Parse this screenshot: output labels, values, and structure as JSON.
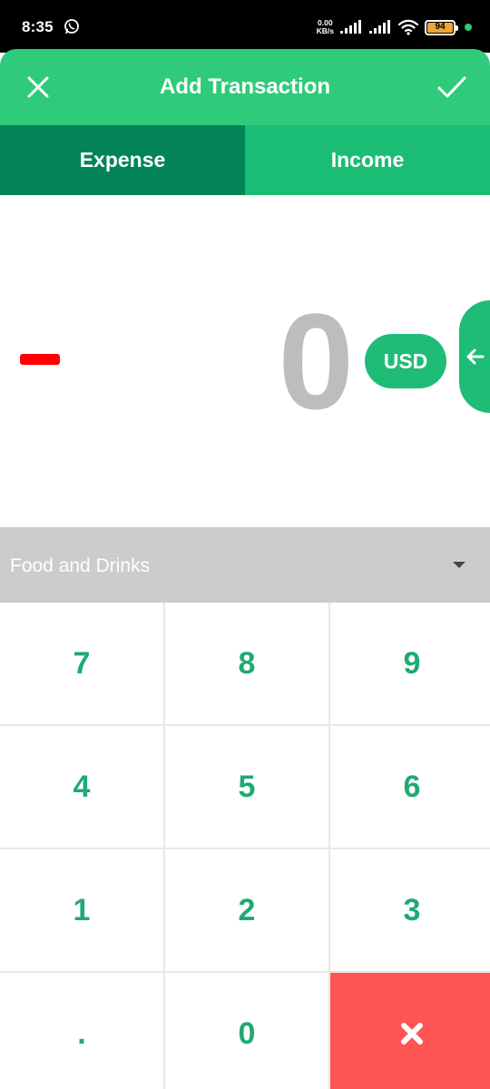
{
  "status_bar": {
    "time": "8:35",
    "net_speed_value": "0.00",
    "net_speed_unit": "KB/s",
    "battery": "94",
    "icons": [
      "whatsapp-icon",
      "signal-icon",
      "signal-icon",
      "wifi-icon",
      "battery-icon"
    ]
  },
  "app_bar": {
    "title": "Add Transaction",
    "close_icon": "close-icon",
    "confirm_icon": "check-icon"
  },
  "tabs": [
    {
      "label": "Expense",
      "active": true
    },
    {
      "label": "Income",
      "active": false
    }
  ],
  "amount": {
    "sign": "minus",
    "value": "0",
    "currency": "USD"
  },
  "category": {
    "selected": "Food and Drinks"
  },
  "keypad": {
    "keys": [
      "7",
      "8",
      "9",
      "4",
      "5",
      "6",
      "1",
      "2",
      "3",
      ".",
      "0"
    ],
    "delete_icon": "delete-x-icon"
  },
  "colors": {
    "app_bar": "#2fcb7a",
    "tab_active": "#028457",
    "tab_inactive": "#1bbd75",
    "accent": "#1fbc78",
    "key_text": "#1eaa72",
    "minus": "#ff0000",
    "delete_key": "#ff5454",
    "category_bg": "#cccccc"
  }
}
